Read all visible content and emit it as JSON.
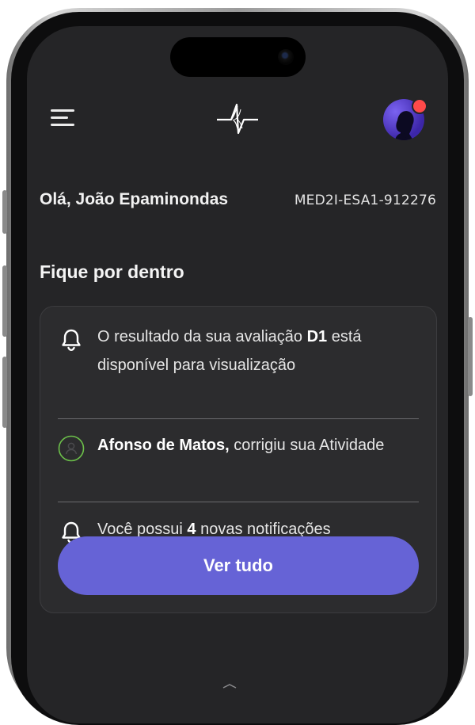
{
  "header": {
    "menu_icon": "hamburger-menu-icon",
    "logo_icon": "waveform-logo-icon",
    "avatar_icon": "user-avatar",
    "notification_color": "#ff4a4a"
  },
  "user": {
    "greeting": "Olá, João Epaminondas",
    "code": "MED2I-ESA1-912276"
  },
  "feed": {
    "title": "Fique por dentro",
    "items": [
      {
        "icon": "bell-icon",
        "text_before": "O resultado da sua avaliação ",
        "bold": "D1",
        "text_after": " está disponível para visualização"
      },
      {
        "icon": "user-circle-icon",
        "bold": "Afonso de Matos,",
        "text_after": " corrigiu sua Atividade"
      },
      {
        "icon": "bell-icon",
        "text_before": "Você possui ",
        "bold": "4",
        "text_after": " novas notificações"
      }
    ],
    "cta_label": "Ver tudo"
  },
  "colors": {
    "background": "#252527",
    "card": "#2c2c2e",
    "accent": "#6663d6",
    "user_icon_ring": "#6cc04a"
  }
}
